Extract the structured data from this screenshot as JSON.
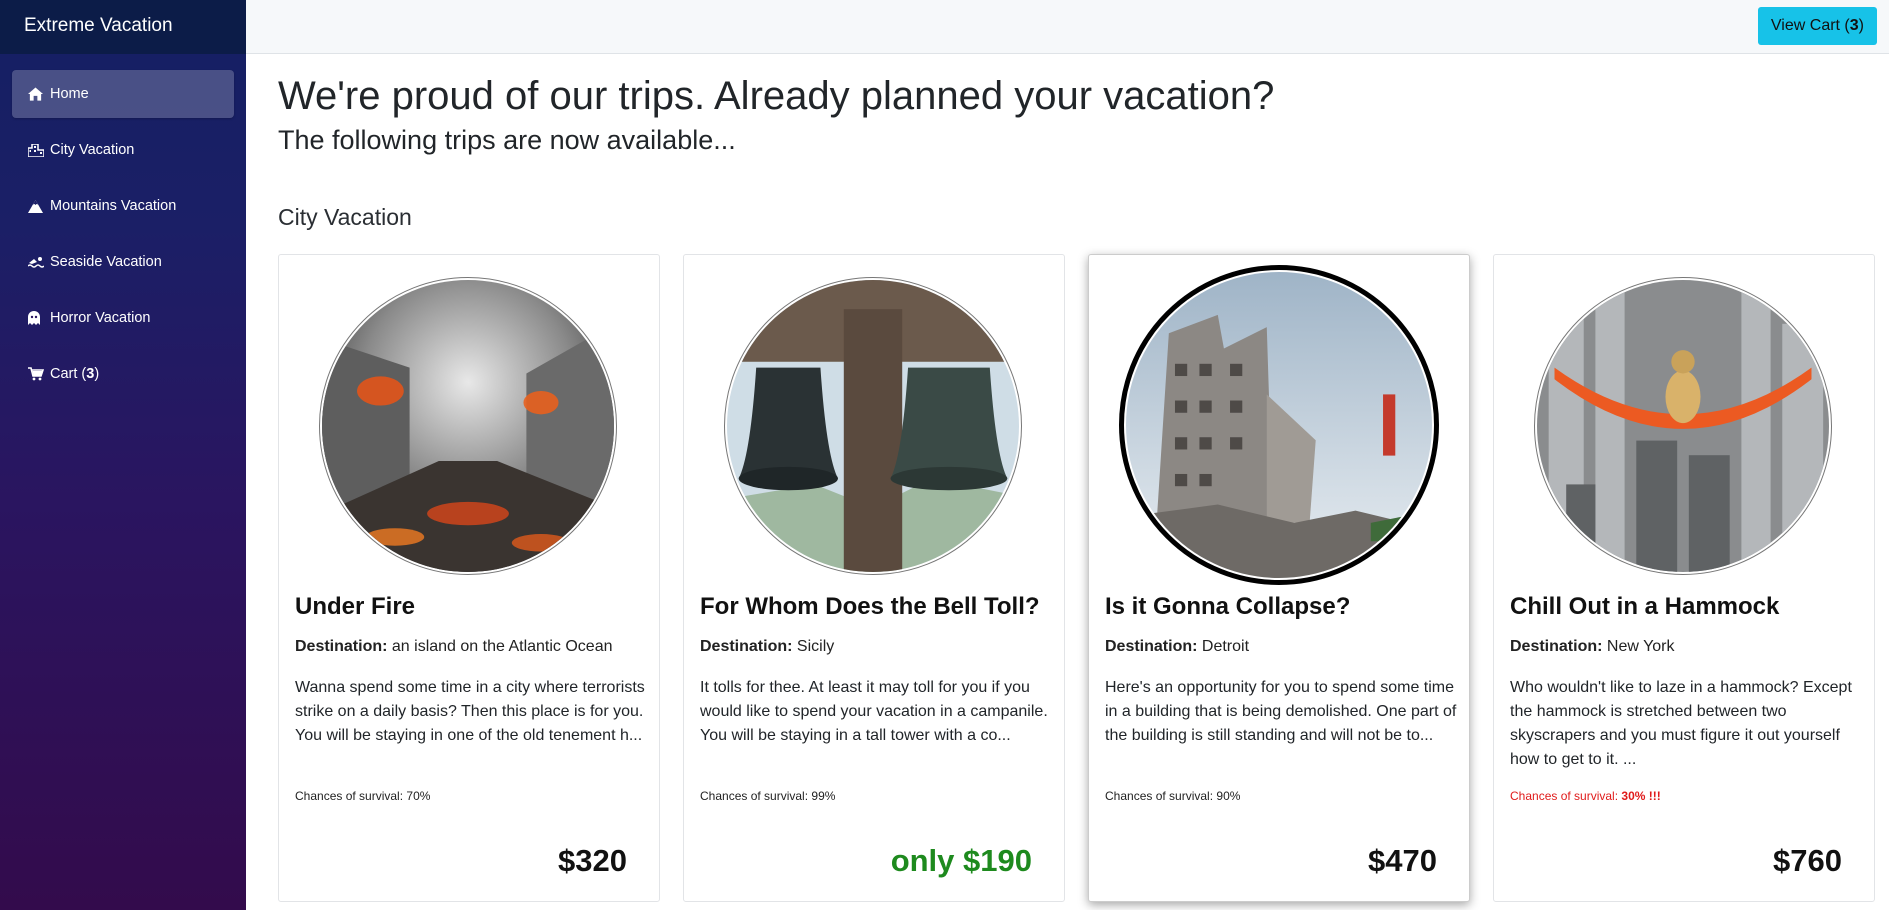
{
  "app": {
    "brand": "Extreme Vacation"
  },
  "sidebar": {
    "items": [
      {
        "label": "Home",
        "icon": "home-icon",
        "active": true
      },
      {
        "label": "City Vacation",
        "icon": "city-icon"
      },
      {
        "label": "Mountains Vacation",
        "icon": "mountain-icon"
      },
      {
        "label": "Seaside Vacation",
        "icon": "swimmer-icon"
      },
      {
        "label": "Horror Vacation",
        "icon": "ghost-icon"
      },
      {
        "label": "Cart",
        "icon": "cart-icon",
        "count": "3"
      }
    ]
  },
  "topbar": {
    "cart_label": "View Cart",
    "cart_count": "3"
  },
  "main": {
    "heading": "We're proud of our trips. Already planned your vacation?",
    "subheading": "The following trips are now available...",
    "section_title": "City Vacation"
  },
  "cards": [
    {
      "title": "Under Fire",
      "dest_label": "Destination:",
      "destination": "an island on the Atlantic Ocean",
      "description": "Wanna spend some time in a city where terrorists strike on a daily basis? Then this place is for you. You will be staying in one of the old tenement h...",
      "survival_label": "Chances of survival: ",
      "survival": "70%",
      "survival_suffix": "",
      "price": "$320",
      "image": "burning-street"
    },
    {
      "title": "For Whom Does the Bell Toll?",
      "dest_label": "Destination:",
      "destination": "Sicily",
      "description": "It tolls for thee. At least it may toll for you if you would like to spend your vacation in a campanile. You will be staying in a tall tower with a co...",
      "survival_label": "Chances of survival: ",
      "survival": "99%",
      "survival_suffix": "",
      "price": "only $190",
      "image": "church-bells"
    },
    {
      "title": "Is it Gonna Collapse?",
      "dest_label": "Destination:",
      "destination": "Detroit",
      "description": "Here's an opportunity for you to spend some time in a building that is being demolished. One part of the building is still standing and will not be to...",
      "survival_label": "Chances of survival: ",
      "survival": "90%",
      "survival_suffix": "",
      "price": "$470",
      "image": "ruined-building"
    },
    {
      "title": "Chill Out in a Hammock",
      "dest_label": "Destination:",
      "destination": "New York",
      "description": "Who wouldn't like to laze in a hammock? Except the hammock is stretched between two skyscrapers and you must figure it out yourself how to get to it. ...",
      "survival_label": "Chances of survival: ",
      "survival": "30%",
      "survival_suffix": " !!!",
      "price": "$760",
      "image": "hammock-skyscrapers"
    }
  ]
}
